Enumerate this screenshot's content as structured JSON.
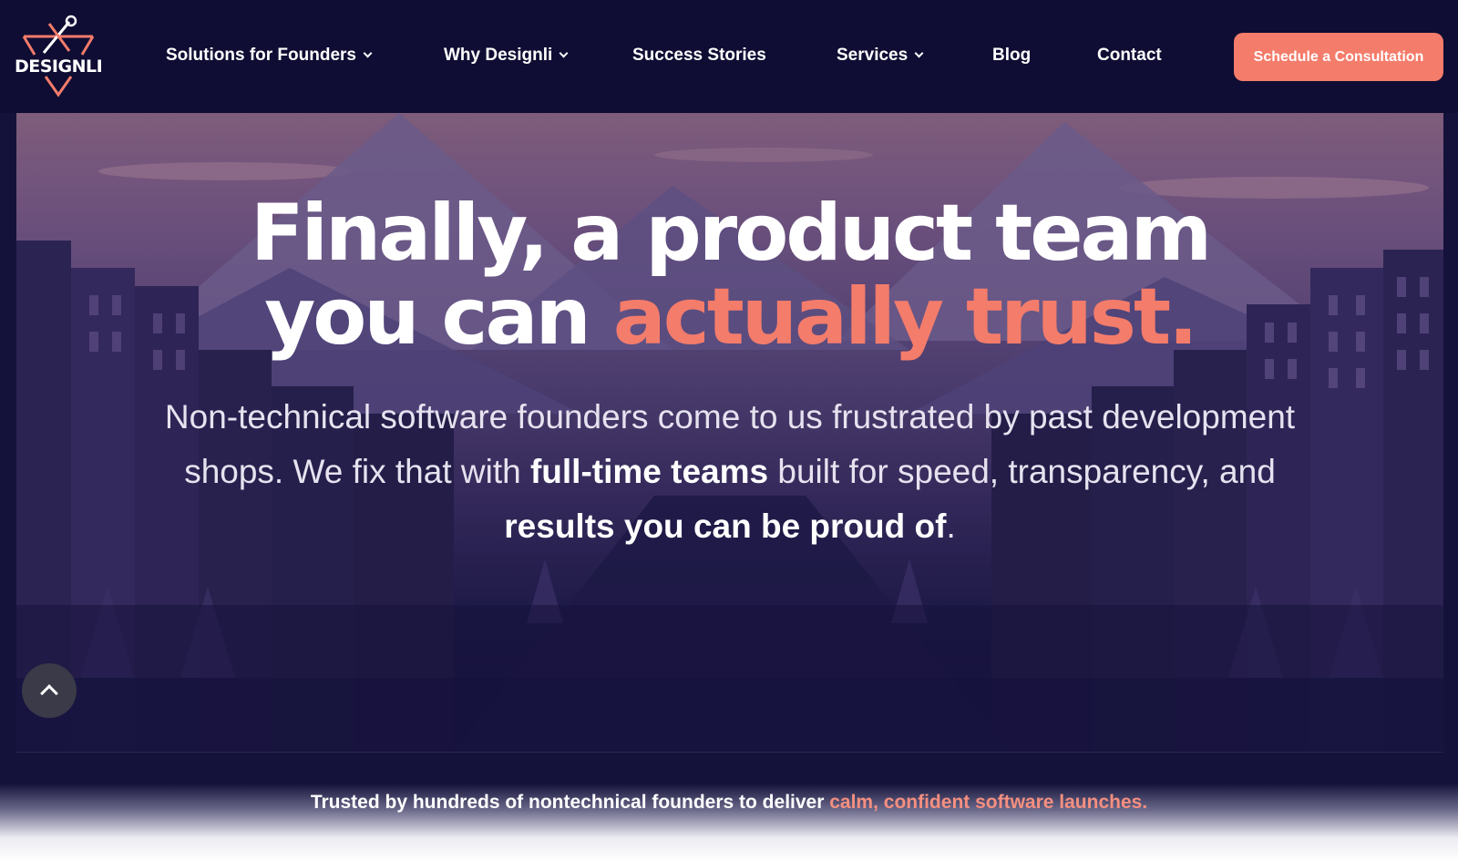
{
  "brand": {
    "logo_text": "DESIGNLI",
    "accent_color": "#f47c6b",
    "navy_color": "#0f0d33"
  },
  "nav": {
    "items": [
      {
        "label": "Solutions for Founders",
        "has_dropdown": true
      },
      {
        "label": "Why Designli",
        "has_dropdown": true
      },
      {
        "label": "Success Stories",
        "has_dropdown": false
      },
      {
        "label": "Services",
        "has_dropdown": true
      },
      {
        "label": "Blog",
        "has_dropdown": false
      },
      {
        "label": "Contact",
        "has_dropdown": false
      }
    ],
    "cta_label": "Schedule a Consultation"
  },
  "hero": {
    "title_line1": "Finally, a product team",
    "title_line2_prefix": "you can ",
    "title_line2_accent": "actually trust.",
    "sub_part1": "Non-technical software founders come to us frustrated by past development shops. We fix that with ",
    "sub_bold1": "full-time teams",
    "sub_part2": " built for speed, transparency, and ",
    "sub_bold2": "results you can be proud of",
    "sub_part3": "."
  },
  "scroll_top": {
    "icon": "chevron-up-icon"
  },
  "trust_bar": {
    "text": "Trusted by hundreds of nontechnical founders to deliver ",
    "accent": "calm, confident software launches."
  }
}
